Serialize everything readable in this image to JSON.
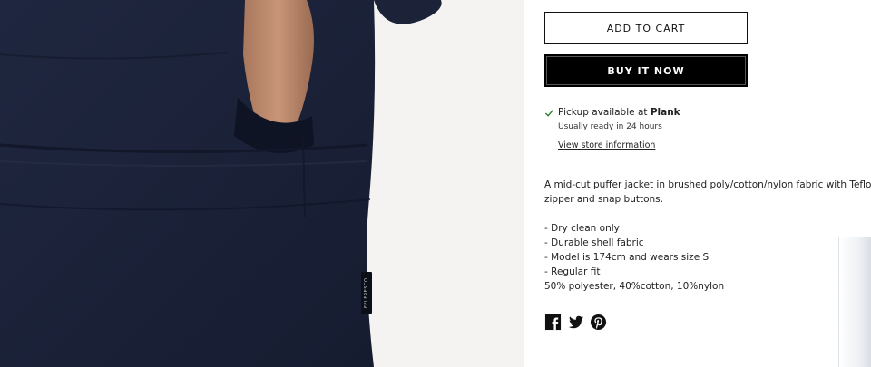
{
  "buttons": {
    "add_to_cart": "ADD TO CART",
    "buy_now": "BUY IT NOW"
  },
  "pickup": {
    "prefix": "Pickup available at ",
    "location": "Plank",
    "ready": "Usually ready in 24 hours",
    "link": "View store information"
  },
  "description": {
    "line1": "A mid-cut puffer jacket in brushed poly/cotton/nylon fabric with Teflo",
    "line2": "zipper and snap buttons.",
    "bullets": [
      "- Dry clean only",
      "- Durable shell fabric",
      "- Model is 174cm and wears size S",
      "- Regular fit"
    ],
    "composition": "50% polyester, 40%cotton, 10%nylon"
  },
  "image": {
    "tag_text": "FELFRESCO",
    "jacket_color": "#1b2238"
  },
  "social": [
    "facebook-icon",
    "twitter-icon",
    "pinterest-icon"
  ]
}
